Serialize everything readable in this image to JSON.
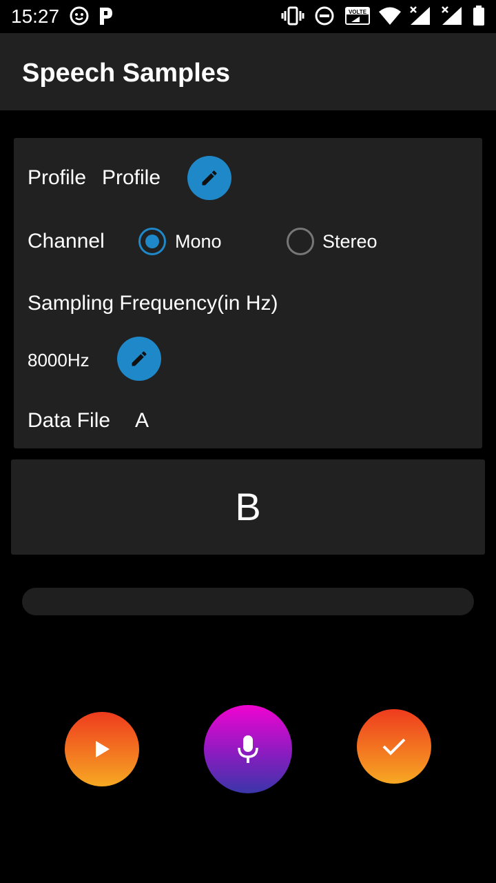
{
  "status_bar": {
    "time": "15:27",
    "icons": [
      "face-notification-icon",
      "p-notification-icon",
      "vibrate-icon",
      "do-not-disturb-icon",
      "volte-icon",
      "wifi-icon",
      "signal-icon",
      "signal-icon",
      "battery-icon"
    ],
    "volte_label": "VOLTE"
  },
  "app_bar": {
    "title": "Speech Samples"
  },
  "settings": {
    "profile_label": "Profile",
    "profile_value": "Profile",
    "channel_label": "Channel",
    "channel_options": [
      {
        "label": "Mono",
        "selected": true
      },
      {
        "label": "Stereo",
        "selected": false
      }
    ],
    "sampling_label": "Sampling Frequency(in Hz)",
    "sampling_value": "8000Hz",
    "data_file_label": "Data File",
    "data_file_value": "A"
  },
  "word_card": {
    "text": "B"
  },
  "progress": {
    "value": 0
  },
  "actions": {
    "play_icon": "play-icon",
    "record_icon": "microphone-icon",
    "done_icon": "check-icon"
  },
  "colors": {
    "accent": "#1e88c8",
    "surface": "#212121",
    "background": "#000000"
  }
}
